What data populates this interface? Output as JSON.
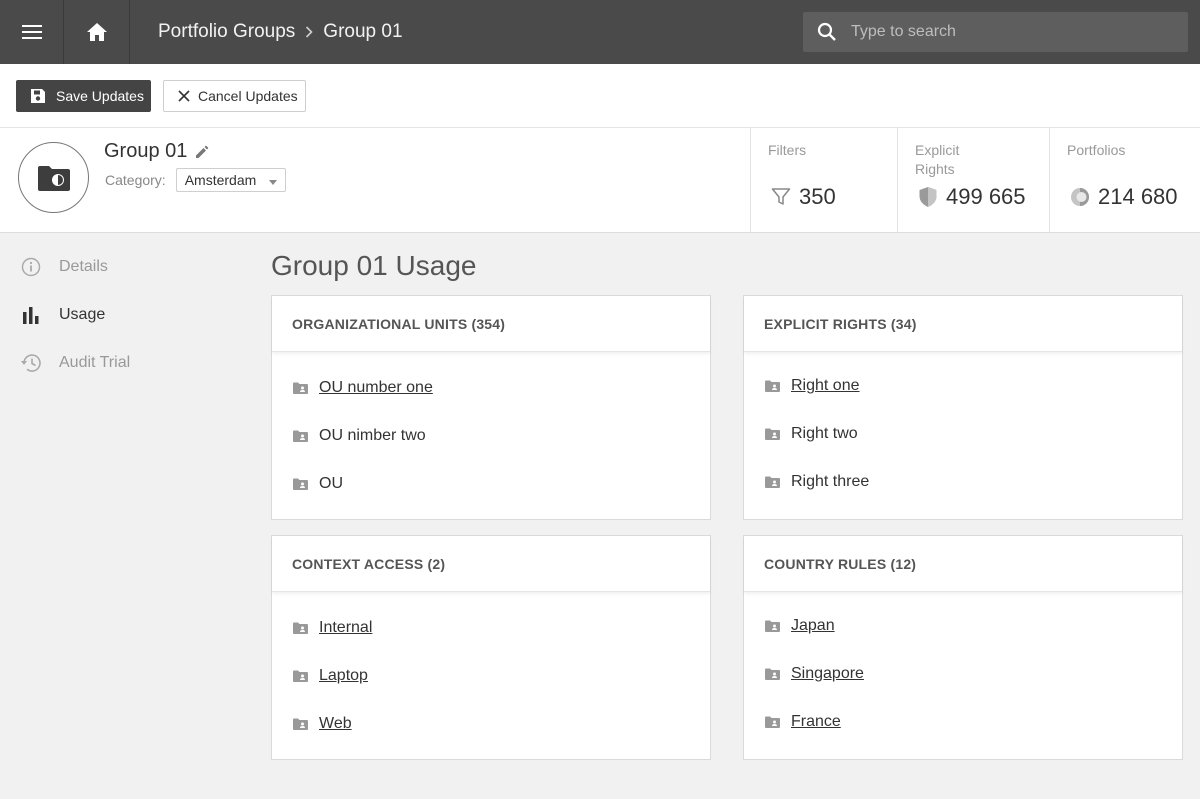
{
  "topbar": {
    "breadcrumb": [
      "Portfolio Groups",
      "Group 01"
    ],
    "search_placeholder": "Type to search"
  },
  "toolbar": {
    "save_label": "Save Updates",
    "cancel_label": "Cancel Updates"
  },
  "header": {
    "group_name": "Group 01",
    "category_label": "Category:",
    "category_value": "Amsterdam",
    "stats": {
      "filters": {
        "label": "Filters",
        "value": "350"
      },
      "explicit_rights": {
        "label_line1": "Explicit",
        "label_line2": "Rights",
        "value": "499 665"
      },
      "portfolios": {
        "label": "Portfolios",
        "value": "214 680"
      }
    }
  },
  "sidebar": {
    "items": [
      {
        "label": "Details",
        "icon": "info-icon",
        "active": false
      },
      {
        "label": "Usage",
        "icon": "bar-chart-icon",
        "active": true
      },
      {
        "label": "Audit Trial",
        "icon": "history-icon",
        "active": false
      }
    ]
  },
  "main": {
    "title": "Group 01 Usage",
    "cards": {
      "org_units": {
        "title": "ORGANIZATIONAL UNITS (354)",
        "items": [
          {
            "label": "OU number one",
            "link": true
          },
          {
            "label": "OU nimber two",
            "link": false
          },
          {
            "label": "OU",
            "link": false
          }
        ]
      },
      "explicit_rights": {
        "title": "EXPLICIT RIGHTS (34)",
        "items": [
          {
            "label": "Right one",
            "link": true
          },
          {
            "label": "Right two",
            "link": false
          },
          {
            "label": "Right three",
            "link": false
          }
        ]
      },
      "context_access": {
        "title": "CONTEXT ACCESS (2)",
        "items": [
          {
            "label": "Internal",
            "link": true
          },
          {
            "label": "Laptop",
            "link": true
          },
          {
            "label": "Web",
            "link": true
          }
        ]
      },
      "country_rules": {
        "title": "COUNTRY RULES (12)",
        "items": [
          {
            "label": "Japan",
            "link": true
          },
          {
            "label": "Singapore",
            "link": true
          },
          {
            "label": "France",
            "link": true
          }
        ]
      }
    }
  },
  "colors": {
    "topbar_bg": "#4a4a4a",
    "save_button_bg": "#444444",
    "page_bg": "#f1f1f1",
    "muted_text": "#999999"
  }
}
